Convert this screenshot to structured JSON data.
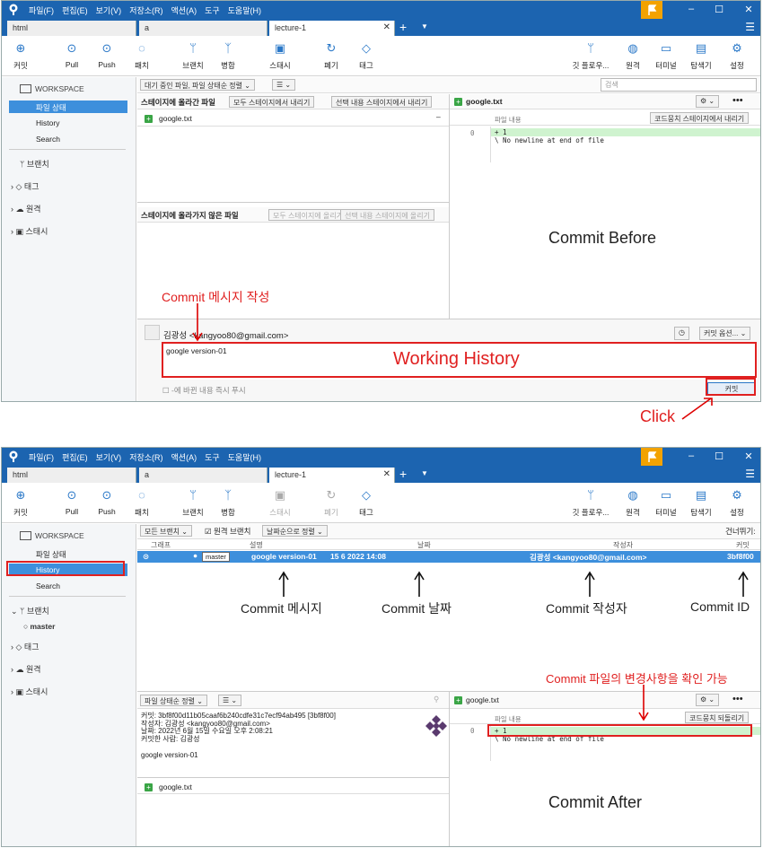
{
  "titlebar": {
    "menus": [
      "파일(F)",
      "편집(E)",
      "보기(V)",
      "저장소(R)",
      "액션(A)",
      "도구",
      "도움말(H)"
    ],
    "min": "–",
    "max": "☐",
    "close": "✕"
  },
  "tabs": [
    "html",
    "a",
    "lecture-1"
  ],
  "toolbar": {
    "left": [
      "커밋",
      "Pull",
      "Push",
      "패치",
      "브랜치",
      "병합",
      "스태시",
      "폐기",
      "태그"
    ],
    "right": [
      "깃 플로우...",
      "원격",
      "터미널",
      "탐색기",
      "설정"
    ]
  },
  "sidebar": {
    "workspace": "WORKSPACE",
    "items": [
      "파일 상태",
      "History",
      "Search"
    ],
    "sections": [
      "브랜치",
      "태그",
      "원격",
      "스태시"
    ],
    "branch_master": "master"
  },
  "top": {
    "filter": "대기 중인 파일, 파일 상태순 정렬",
    "search_placeholder": "검색",
    "staged_title": "스테이지에 올라간 파일",
    "unstage_all": "모두 스테이지에서 내리기",
    "unstage_sel": "선택 내용 스테이지에서 내리기",
    "staged_file": "google.txt",
    "unstaged_title": "스테이지에 올라가지 않은 파일",
    "stage_all": "모두 스테이지에 올리기",
    "stage_sel": "선택 내용 스테이지에 올리기",
    "diff_file": "google.txt",
    "diff_header": "파일 내용",
    "diff_btn": "코드뭉치 스테이지에서 내리기",
    "diff_lineno": "0",
    "diff_line1": "+ 1",
    "diff_line2": "\\ No newline at end of file",
    "author": "김광성 <kangyoo80@gmail.com>",
    "message": "google version-01",
    "commit_opts": "커밋 옵션...",
    "push_now": "-에 바뀐 내용 즉시 푸시",
    "commit_btn": "커밋"
  },
  "annotations": {
    "commit_msg": "Commit 메시지 작성",
    "working_history": "Working History",
    "commit_before": "Commit Before",
    "click": "Click",
    "commit_message": "Commit 메시지",
    "commit_date": "Commit 날짜",
    "commit_author": "Commit 작성자",
    "commit_id": "Commit ID",
    "commit_file": "Commit 파일의 변경사항을 확인 가능",
    "commit_after": "Commit After"
  },
  "bottom": {
    "branch_filter": "모든 브랜치",
    "remote_branch": "원격 브랜치",
    "date_sort": "날짜순으로 정렬",
    "skip": "건너뛰기:",
    "cols": [
      "그래프",
      "설명",
      "날짜",
      "작성자",
      "커밋"
    ],
    "row": {
      "branch": "master",
      "desc": "google version-01",
      "date": "15 6 2022 14:08",
      "author": "김광성 <kangyoo80@gmail.com>",
      "id": "3bf8f00"
    },
    "sort2": "파일 상태순 정렬",
    "details": [
      "커밋: 3bf8f00d11b05caaf6b240cdfe31c7ecf94ab495 [3bf8f00]",
      "작성자: 김광성 <kangyoo80@gmail.com>",
      "날짜: 2022년 6월 15일 수요일 오후 2:08:21",
      "커밋한 사람: 김광성"
    ],
    "detail_msg": "google version-01",
    "file": "google.txt",
    "diff_file": "google.txt",
    "diff_header": "파일 내용",
    "diff_btn": "코드뭉치 되돌리기",
    "diff_lineno": "0",
    "diff_line1": "+ 1",
    "diff_line2": "\\ No newline at end of file"
  }
}
